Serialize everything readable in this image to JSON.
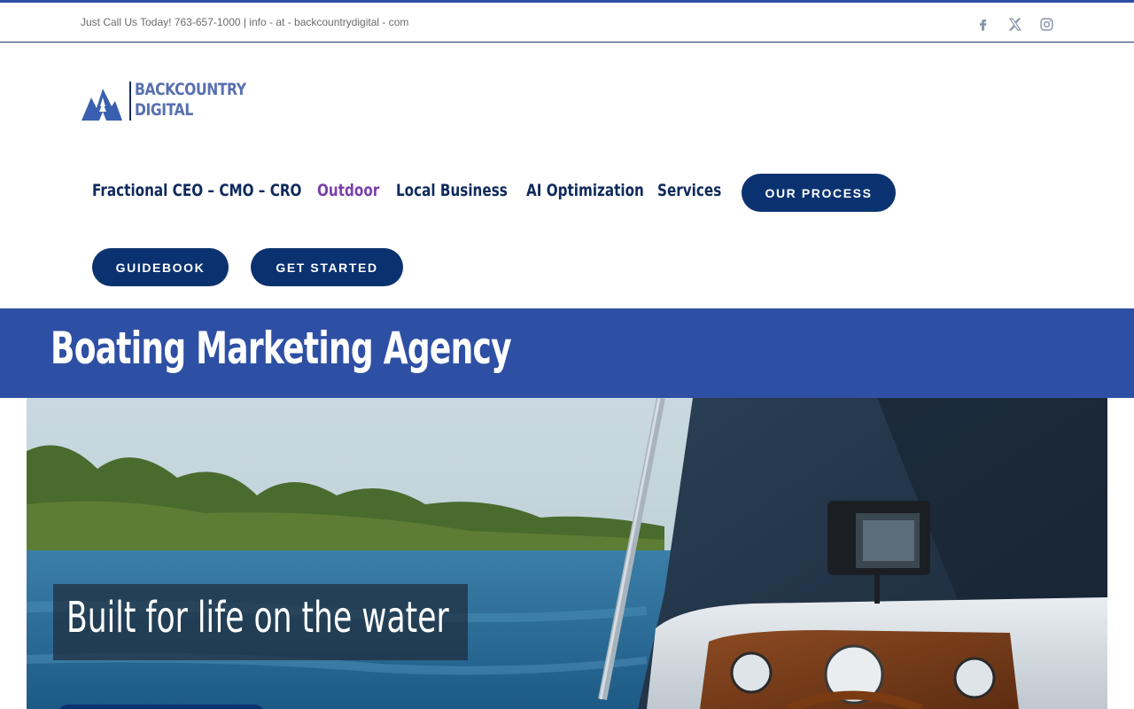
{
  "topbar": {
    "contact_text": "Just Call Us Today! 763-657-1000  |  info - at - backcountrydigital - com",
    "social": [
      {
        "icon": "facebook-icon"
      },
      {
        "icon": "x-twitter-icon"
      },
      {
        "icon": "instagram-icon"
      }
    ]
  },
  "logo": {
    "line1": "BACKCOUNTRY",
    "line2": "DIGITAL"
  },
  "nav": {
    "items": [
      {
        "label": "Fractional CEO – CMO – CRO"
      },
      {
        "label": "Outdoor"
      },
      {
        "label": "Local Business"
      },
      {
        "label": "AI Optimization"
      },
      {
        "label": "Services"
      }
    ],
    "buttons": {
      "our_process": "OUR PROCESS",
      "guidebook": "GUIDEBOOK",
      "get_started": "GET STARTED"
    }
  },
  "page": {
    "title": "Boating Marketing Agency"
  },
  "hero": {
    "caption": "Built for life on the water"
  },
  "colors": {
    "brand_blue": "#2e50a4",
    "navy": "#0b3270",
    "active_nav": "#7a3fa8"
  }
}
